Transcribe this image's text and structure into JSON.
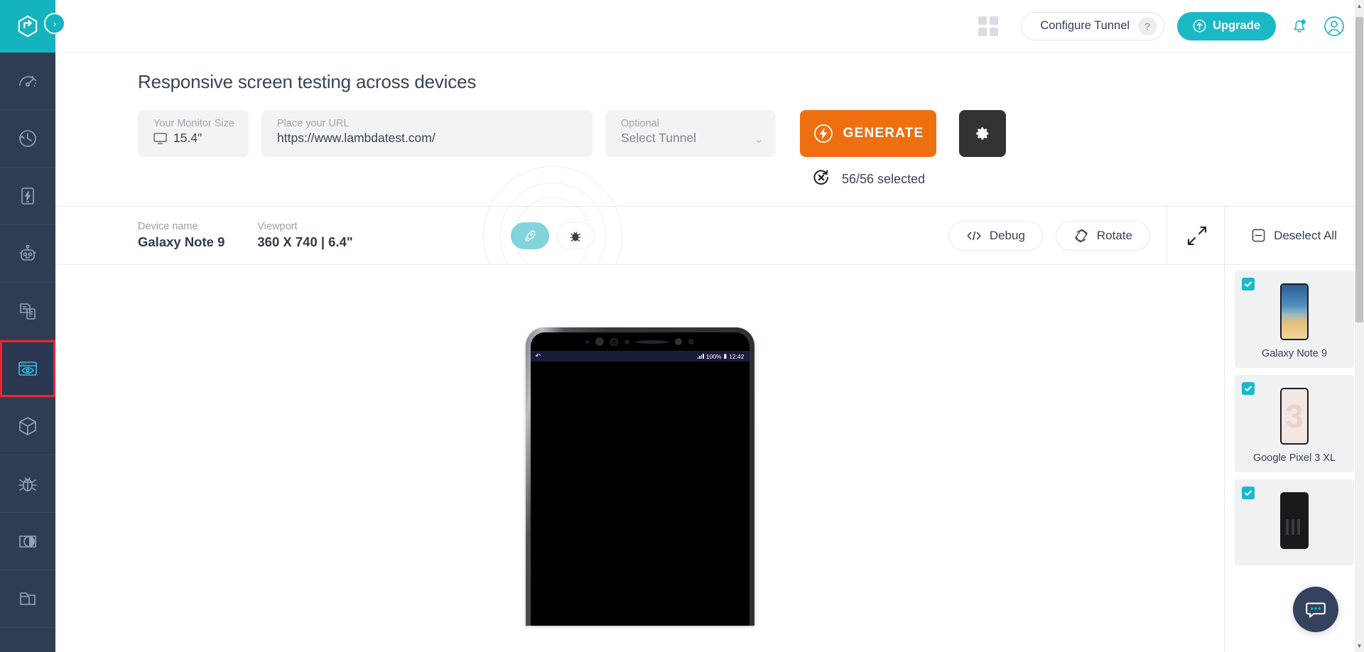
{
  "brand": {
    "accent_teal": "#19b9c6",
    "accent_orange": "#ee6f10",
    "sidebar_navy": "#2f3c53",
    "highlight_red": "#e8262d"
  },
  "sidebar": {
    "logo_name": "lambdatest-logo",
    "expand_label": "›",
    "items": [
      {
        "name": "dashboard",
        "icon": "speedometer-icon",
        "active": false
      },
      {
        "name": "history",
        "icon": "clock-history-icon",
        "active": false
      },
      {
        "name": "realtime",
        "icon": "mobile-lightning-icon",
        "active": false
      },
      {
        "name": "automation",
        "icon": "robot-icon",
        "active": false
      },
      {
        "name": "screenshot",
        "icon": "documents-icon",
        "active": false
      },
      {
        "name": "responsive",
        "icon": "browser-eye-icon",
        "active": true
      },
      {
        "name": "integrations",
        "icon": "cube-icon",
        "active": false
      },
      {
        "name": "issue-tracker",
        "icon": "bug-icon",
        "active": false
      },
      {
        "name": "smart-visual",
        "icon": "contrast-compare-icon",
        "active": false
      },
      {
        "name": "projects",
        "icon": "folder-icon",
        "active": false
      }
    ]
  },
  "topbar": {
    "apps_icon": "grid-apps-icon",
    "tunnel_label": "Configure Tunnel",
    "help_label": "?",
    "upgrade_label": "Upgrade",
    "upgrade_icon": "arrow-up-circle-icon",
    "notifications_icon": "bell-icon",
    "account_icon": "user-avatar-icon"
  },
  "page": {
    "title": "Responsive screen testing across devices",
    "monitor": {
      "label": "Your Monitor Size",
      "value": "15.4\"",
      "icon": "monitor-icon"
    },
    "url": {
      "label": "Place your URL",
      "value": "https://www.lambdatest.com/",
      "placeholder": "https://www.lambdatest.com/"
    },
    "tunnel": {
      "label": "Optional",
      "value": "Select Tunnel",
      "chevron": "⌄"
    },
    "generate_label": "GENERATE",
    "generate_icon": "lightning-bolt-icon",
    "settings_icon": "gear-icon",
    "selected_count": "56/56 selected",
    "reset_icon": "reset-circle-x-icon"
  },
  "preview": {
    "device_name_label": "Device name",
    "device_name_value": "Galaxy Note 9",
    "viewport_label": "Viewport",
    "viewport_value": "360 X 740 | 6.4\"",
    "mode_rocket_icon": "rocket-icon",
    "mode_bug_icon": "bug-icon",
    "debug_label": "Debug",
    "debug_icon": "code-brackets-icon",
    "rotate_label": "Rotate",
    "rotate_icon": "rotate-screen-icon",
    "expand_icon": "fullscreen-expand-icon",
    "phone_status": {
      "battery": "100%",
      "time": "12:42",
      "signal_icon": "signal-bars-icon",
      "battery_icon": "battery-icon",
      "refresh_icon": "refresh-icon"
    }
  },
  "device_panel": {
    "deselect_label": "Deselect All",
    "deselect_icon": "minus-square-icon",
    "devices": [
      {
        "name": "Galaxy Note 9",
        "checked": true,
        "thumb": "thumb-note9"
      },
      {
        "name": "Google Pixel 3 XL",
        "checked": true,
        "thumb": "thumb-pixel"
      },
      {
        "name": "",
        "checked": true,
        "thumb": "thumb-dark"
      }
    ]
  },
  "chat": {
    "icon": "chat-bubble-icon"
  }
}
